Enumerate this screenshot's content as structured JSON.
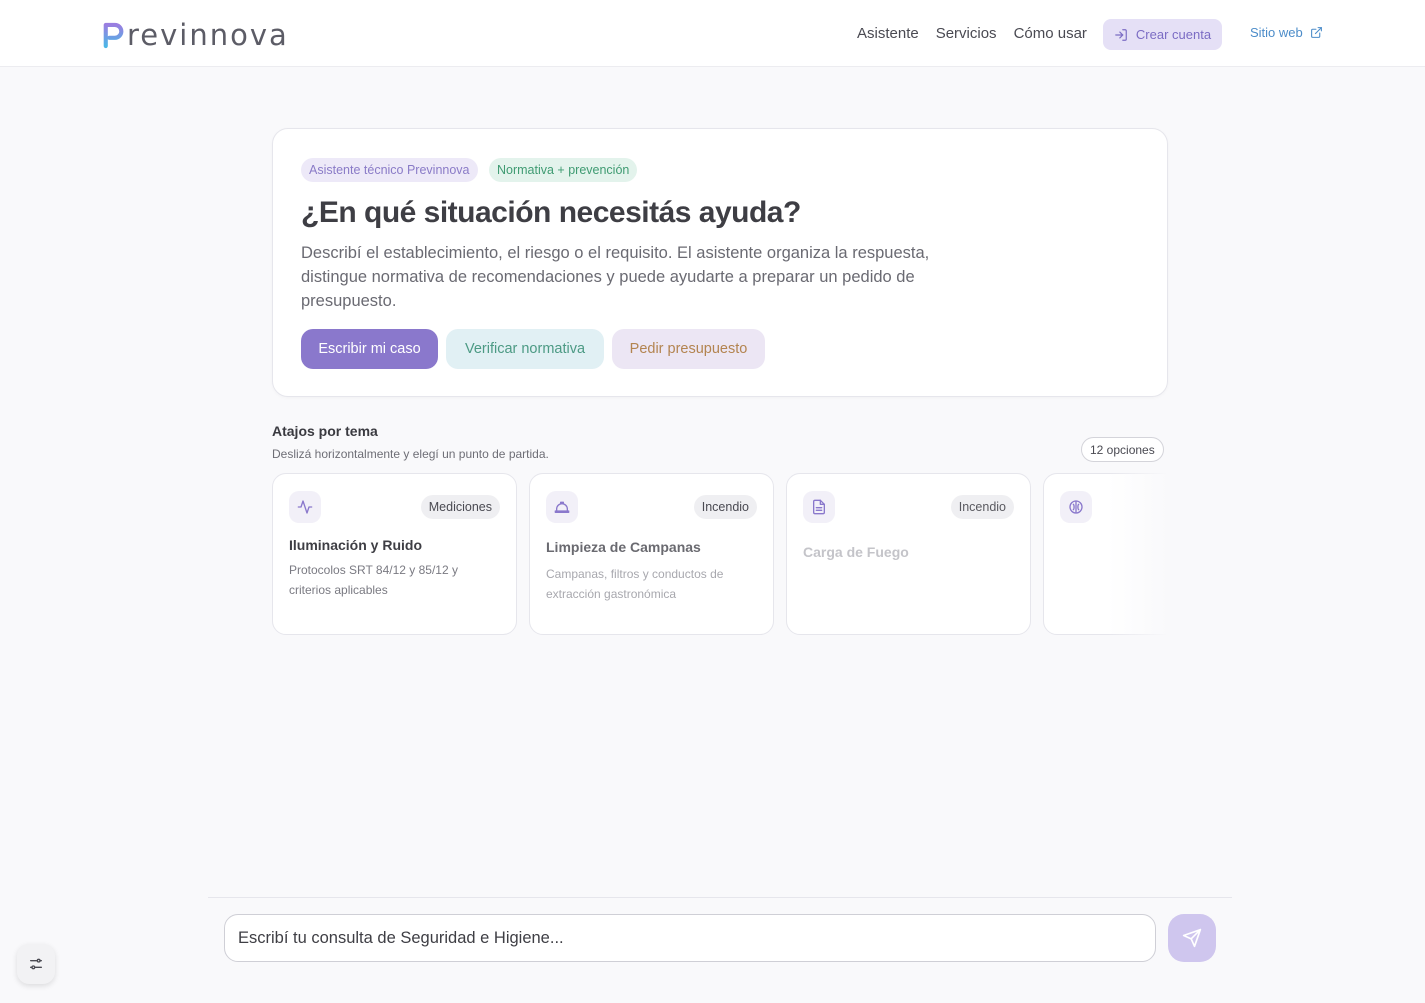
{
  "brand": {
    "name": "revinnova",
    "logo_letter": "P"
  },
  "nav": {
    "links": [
      "Asistente",
      "Servicios",
      "Cómo usar"
    ],
    "create_account": "Crear cuenta",
    "website": "Sitio web"
  },
  "hero": {
    "tags": [
      "Asistente técnico Previnnova",
      "Normativa + prevención"
    ],
    "title": "¿En qué situación necesitás ayuda?",
    "description": "Describí el establecimiento, el riesgo o el requisito. El asistente organiza la respuesta, distingue normativa de recomendaciones y puede ayudarte a preparar un pedido de presupuesto.",
    "buttons": [
      "Escribir mi caso",
      "Verificar normativa",
      "Pedir presupuesto"
    ]
  },
  "shortcuts": {
    "title": "Atajos por tema",
    "subtitle": "Deslizá horizontalmente y elegí un punto de partida.",
    "count": "12 opciones",
    "cards": [
      {
        "icon": "activity-icon",
        "tag": "Mediciones",
        "title": "Iluminación y Ruido",
        "description": "Protocolos SRT 84/12 y 85/12 y criterios aplicables"
      },
      {
        "icon": "hard-hat-icon",
        "tag": "Incendio",
        "title": "Limpieza de Campanas",
        "description": "Campanas, filtros y conductos de extracción gastronómica"
      },
      {
        "icon": "document-icon",
        "tag": "Incendio",
        "title": "Carga de Fuego",
        "description": ""
      },
      {
        "icon": "brain-icon",
        "tag": "",
        "title": "",
        "description": ""
      }
    ]
  },
  "composer": {
    "placeholder": "Escribí tu consulta de Seguridad e Higiene...",
    "send_icon": "send-icon",
    "settings_icon": "sliders-icon"
  },
  "colors": {
    "accent": "#8a78cc",
    "accent_light": "#e5e0f6",
    "link": "#4c8cc9",
    "green": "#3f9b72"
  }
}
